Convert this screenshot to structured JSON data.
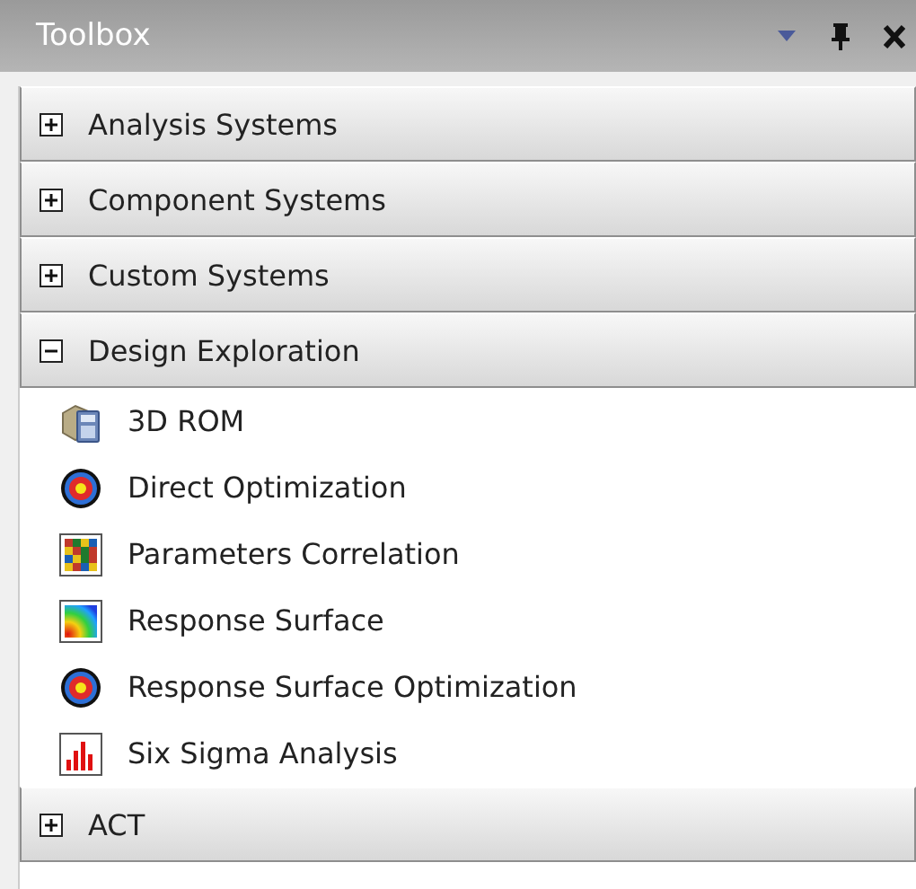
{
  "panel": {
    "title": "Toolbox"
  },
  "sections": [
    {
      "label": "Analysis Systems",
      "expanded": false
    },
    {
      "label": "Component Systems",
      "expanded": false
    },
    {
      "label": "Custom Systems",
      "expanded": false
    },
    {
      "label": "Design Exploration",
      "expanded": true,
      "items": [
        {
          "label": "3D ROM",
          "kind": "model"
        },
        {
          "label": "Direct Optimization",
          "kind": "target"
        },
        {
          "label": "Parameters Correlation",
          "kind": "matrix"
        },
        {
          "label": "Response Surface",
          "kind": "surface"
        },
        {
          "label": "Response Surface Optimization",
          "kind": "target"
        },
        {
          "label": "Six Sigma Analysis",
          "kind": "bars"
        }
      ]
    },
    {
      "label": "ACT",
      "expanded": false
    }
  ]
}
